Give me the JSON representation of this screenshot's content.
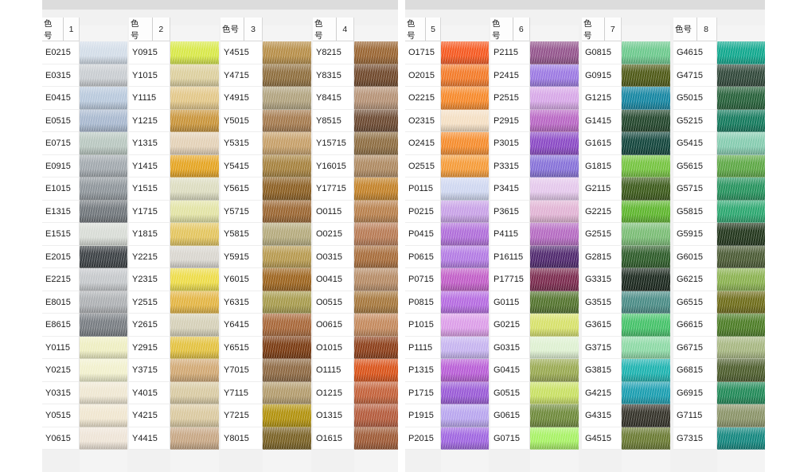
{
  "header_label": "色号",
  "panels": [
    {
      "groups": [
        {
          "number": "1",
          "codes": [
            "E0215",
            "E0315",
            "E0415",
            "E0515",
            "E0715",
            "E0915",
            "E1015",
            "E1315",
            "E1515",
            "E2015",
            "E2215",
            "E8015",
            "E8615",
            "Y0115",
            "Y0215",
            "Y0315",
            "Y0515",
            "Y0615"
          ],
          "colors": [
            "#d3dde8",
            "#c9cdd1",
            "#b9c9dc",
            "#a9b9cf",
            "#b9c7c0",
            "#a2a9ae",
            "#8f969b",
            "#71777c",
            "#d8dcd6",
            "#3c4145",
            "#c5c8cb",
            "#aeb1b4",
            "#787d82",
            "#eeeec2",
            "#f1f0cd",
            "#efe7d2",
            "#f0e6d0",
            "#eee4d7"
          ]
        },
        {
          "number": "2",
          "codes": [
            "Y0915",
            "Y1015",
            "Y1115",
            "Y1215",
            "Y1315",
            "Y1415",
            "Y1515",
            "Y1715",
            "Y1815",
            "Y2215",
            "Y2315",
            "Y2515",
            "Y2615",
            "Y2915",
            "Y3715",
            "Y4015",
            "Y4215",
            "Y4415"
          ],
          "colors": [
            "#d8e84a",
            "#dccf9e",
            "#e2c789",
            "#c9953c",
            "#e3d1b7",
            "#e5a524",
            "#dcdcc0",
            "#e2e3a5",
            "#e3c560",
            "#d9d6cf",
            "#eddc4a",
            "#e3b545",
            "#d5d0b8",
            "#e3c241",
            "#d1a975",
            "#d8caa3",
            "#dac9a0",
            "#c7a785"
          ]
        },
        {
          "number": "3",
          "codes": [
            "Y4515",
            "Y4715",
            "Y4915",
            "Y5015",
            "Y5315",
            "Y5415",
            "Y5615",
            "Y5715",
            "Y5815",
            "Y5915",
            "Y6015",
            "Y6315",
            "Y6415",
            "Y6515",
            "Y7015",
            "Y7115",
            "Y7215",
            "Y8015"
          ],
          "colors": [
            "#b78f4a",
            "#8f6f3f",
            "#b1a37f",
            "#a57b4f",
            "#c6a06a",
            "#a6823f",
            "#8c6024",
            "#9b6733",
            "#b5ab7e",
            "#b79a50",
            "#9d6520",
            "#a79b4e",
            "#a8683a",
            "#7a3b12",
            "#8e6a44",
            "#b39c6e",
            "#b2920e",
            "#7a6226"
          ]
        },
        {
          "number": "4",
          "codes": [
            "Y8215",
            "Y8315",
            "Y8415",
            "Y8515",
            "Y15715",
            "Y16015",
            "Y17715",
            "O0115",
            "O0215",
            "O0315",
            "O0415",
            "O0515",
            "O0615",
            "O1015",
            "O1115",
            "O1215",
            "O1315",
            "O1615"
          ],
          "colors": [
            "#9a6634",
            "#70492c",
            "#b69377",
            "#6c4a32",
            "#8e6e43",
            "#ae8a62",
            "#c3832b",
            "#b8814e",
            "#b87c56",
            "#a76d3c",
            "#b68c67",
            "#a6783e",
            "#c48a5e",
            "#8c3f1a",
            "#d9541b",
            "#c3633c",
            "#b45c3d",
            "#9e5b37"
          ]
        }
      ]
    },
    {
      "groups": [
        {
          "number": "5",
          "codes": [
            "O1715",
            "O2015",
            "O2215",
            "O2315",
            "O2415",
            "O2515",
            "P0115",
            "P0215",
            "P0415",
            "P0615",
            "P0715",
            "P0815",
            "P1015",
            "P1115",
            "P1315",
            "P1715",
            "P1915",
            "P2015"
          ],
          "colors": [
            "#f55a22",
            "#f37b2a",
            "#f68a2c",
            "#f4dfc4",
            "#f58d2f",
            "#f59c3a",
            "#cfd7f0",
            "#c8a2e6",
            "#b06fd9",
            "#b37ce3",
            "#c15fc7",
            "#b56ce0",
            "#dc9ee8",
            "#c6b4ef",
            "#b95fd6",
            "#9a5cd6",
            "#b9a6ee",
            "#a067e0"
          ]
        },
        {
          "number": "6",
          "codes": [
            "P2115",
            "P2415",
            "P2515",
            "P2915",
            "P3015",
            "P3315",
            "P3415",
            "P3615",
            "P4115",
            "P16115",
            "P17715",
            "G0115",
            "G0215",
            "G0315",
            "G0415",
            "G0515",
            "G0615",
            "G0715"
          ],
          "colors": [
            "#94568d",
            "#9c7ae2",
            "#d7a8e7",
            "#b968c4",
            "#8b4bc5",
            "#8772d8",
            "#e4c8eb",
            "#e1b4d4",
            "#b56cc2",
            "#50296e",
            "#7b2c4f",
            "#54742f",
            "#d7e16c",
            "#def0d1",
            "#9aaa53",
            "#c9e065",
            "#6f8a3c",
            "#a8f166"
          ]
        },
        {
          "number": "7",
          "codes": [
            "G0815",
            "G0915",
            "G1215",
            "G1415",
            "G1615",
            "G1815",
            "G2115",
            "G2215",
            "G2515",
            "G2815",
            "G3315",
            "G3515",
            "G3615",
            "G3715",
            "G3815",
            "G4215",
            "G4315",
            "G4515"
          ],
          "colors": [
            "#6ec98e",
            "#4f5a17",
            "#1686a2",
            "#24472d",
            "#14463d",
            "#76c441",
            "#3d5b1c",
            "#5fb62f",
            "#7bbd76",
            "#2e5c2a",
            "#1d2a20",
            "#4b8c86",
            "#46c26a",
            "#8ed9a6",
            "#1fb3b0",
            "#1c9eb0",
            "#35332a",
            "#6b7b34"
          ]
        },
        {
          "number": "8",
          "codes": [
            "G4615",
            "G4715",
            "G5015",
            "G5215",
            "G5415",
            "G5615",
            "G5715",
            "G5815",
            "G5915",
            "G6015",
            "G6215",
            "G6515",
            "G6615",
            "G6715",
            "G6815",
            "G6915",
            "G7115",
            "G7315"
          ],
          "colors": [
            "#12a88e",
            "#31483a",
            "#27613a",
            "#157a5d",
            "#86ccb0",
            "#5ea846",
            "#27935e",
            "#2da770",
            "#23371d",
            "#4b5b35",
            "#8bb251",
            "#6f6d1b",
            "#4d7d27",
            "#a7b782",
            "#4e5e2e",
            "#238a59",
            "#8b9469",
            "#15877f"
          ]
        }
      ]
    }
  ]
}
